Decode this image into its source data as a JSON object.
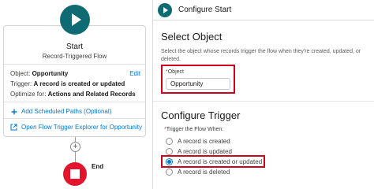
{
  "flow": {
    "start_title": "Start",
    "start_subtitle": "Record-Triggered Flow",
    "object_label": "Object:",
    "object_value": "Opportunity",
    "edit_label": "Edit",
    "trigger_label": "Trigger:",
    "trigger_value": "A record is created or updated",
    "optimize_label": "Optimize for:",
    "optimize_value": "Actions and Related Records",
    "add_paths_label": "Add Scheduled Paths (Optional)",
    "explorer_label": "Open Flow Trigger Explorer for Opportunity",
    "add_symbol": "+",
    "end_label": "End"
  },
  "panel": {
    "header_title": "Configure Start",
    "select_object": {
      "title": "Select Object",
      "description": "Select the object whose records trigger the flow when they're created, updated, or deleted.",
      "required_mark": "*",
      "field_label": "Object",
      "field_value": "Opportunity"
    },
    "configure_trigger": {
      "title": "Configure Trigger",
      "required_mark": "*",
      "group_label": "Trigger the Flow When:",
      "options": [
        {
          "label": "A record is created",
          "selected": false
        },
        {
          "label": "A record is updated",
          "selected": false
        },
        {
          "label": "A record is created or updated",
          "selected": true
        },
        {
          "label": "A record is deleted",
          "selected": false
        }
      ]
    }
  },
  "colors": {
    "start_teal": "#0f6b73",
    "end_red": "#e3142d",
    "link_blue": "#0176d3",
    "highlight_red": "#d0021b"
  }
}
